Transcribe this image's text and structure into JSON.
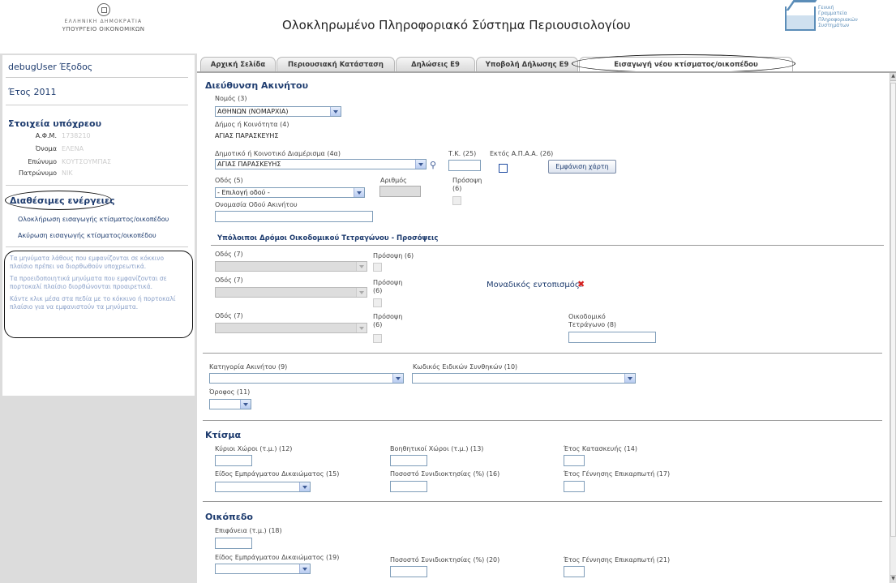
{
  "header": {
    "ministry_line1": "ΕΛΛΗΝΙΚΗ ΔΗΜΟΚΡΑΤΙΑ",
    "ministry_line2": "ΥΠΟΥΡΓΕΙΟ ΟΙΚΟΝΟΜΙΚΩΝ",
    "app_title": "Ολοκληρωμένο Πληροφοριακό Σύστημα Περιουσιολογίου",
    "gsis_text": "Γενική\nΓραμματεία\nΠληροφοριακών\nΣυστημάτων"
  },
  "sidebar": {
    "user": "debugUser",
    "logout": "Έξοδος",
    "year_label": "Έτος 2011",
    "taxpayer_title": "Στοιχεία υπόχρεου",
    "afm_label": "Α.Φ.Μ.",
    "afm_value": "1738210",
    "name_label": "Όνομα",
    "name_value": "ΕΛΕΝΑ",
    "surname_label": "Επώνυμο",
    "surname_value": "ΚΟΥΤΣΟΥΜΠΑΣ",
    "father_label": "Πατρώνυμο",
    "father_value": "ΝΙΚ",
    "actions_title": "Διαθέσιμες ενέργειες",
    "action_complete": "Ολοκλήρωση εισαγωγής κτίσματος/οικοπέδου",
    "action_cancel": "Ακύρωση εισαγωγής κτίσματος/οικοπέδου",
    "help_1": "Τα μηνύματα λάθους που εμφανίζονται σε κόκκινο πλαίσιο πρέπει να διορθωθούν υποχρεωτικά.",
    "help_2": "Τα προειδοποιητικά μηνύματα που εμφανίζονται σε πορτοκαλί πλαίσιο διορθώνονται προαιρετικά.",
    "help_3": "Κάντε κλικ μέσα στα πεδία με το κόκκινο ή πορτοκαλί πλαίσιο για να εμφανιστούν τα μηνύματα."
  },
  "tabs": [
    "Αρχική Σελίδα",
    "Περιουσιακή Κατάσταση",
    "Δηλώσεις Ε9",
    "Υποβολή Δήλωσης Ε9",
    "Εισαγωγή νέου κτίσματος/οικοπέδου"
  ],
  "form": {
    "sec_address": "Διεύθυνση Ακινήτου",
    "nomos_label": "Νομός (3)",
    "nomos_value": "ΑΘΗΝΩΝ (ΝΟΜΑΡΧΙΑ)",
    "dimos_label": "Δήμος ή Κοινότητα (4)",
    "dimos_value": "ΑΓΙΑΣ ΠΑΡΑΣΚΕΥΗΣ",
    "diam_label": "Δημοτικό ή Κοινοτικό Διαμέρισμα (4α)",
    "diam_value": "ΑΓΙΑΣ ΠΑΡΑΣΚΕΥΗΣ",
    "tk_label": "Τ.Κ. (25)",
    "ektos_label": "Εκτός Α.Π.Α.Α. (26)",
    "map_button": "Εμφάνιση χάρτη",
    "odos_label": "Οδός (5)",
    "odos_value": "- Επιλογή οδού -",
    "arithmos_label": "Αριθμός",
    "prosopsi6_label": "Πρόσοψη (6)",
    "onomasia_label": "Ονομασία Οδού Ακινήτου",
    "sub_other": "Υπόλοιποι Δρόμοι Οικοδομικού Τετραγώνου - Προσόψεις",
    "odos7_label": "Οδός (7)",
    "prosopsi_label": "Πρόσοψη (6)",
    "monadikos_label": "Μοναδικός εντοπισμός:",
    "oikodomiko_label": "Οικοδομικό Τετράγωνο (8)",
    "katigoria_label": "Κατηγορία Ακινήτου (9)",
    "kodikos_label": "Κωδικός Ειδικών Συνθηκών (10)",
    "orofos_label": "Όροφος (11)",
    "sec_ktisma": "Κτίσμα",
    "kyrioi_label": "Κύριοι Χώροι (τ.μ.) (12)",
    "voithitikoi_label": "Βοηθητικοί Χώροι (τ.μ.) (13)",
    "etos_kat_label": "Έτος Κατασκευής (14)",
    "eidos15_label": "Είδος Εμπράγματου Δικαιώματος (15)",
    "pososto16_label": "Ποσοστό Συνιδιοκτησίας (%) (16)",
    "etos17_label": "Έτος Γέννησης Επικαρπωτή (17)",
    "sec_oikopedo": "Οικόπεδο",
    "epifaneia_label": "Επιφάνεια (τ.μ.) (18)",
    "eidos19_label": "Είδος Εμπράγματου Δικαιώματος (19)",
    "pososto20_label": "Ποσοστό Συνιδιοκτησίας (%) (20)",
    "etos21_label": "Έτος Γέννησης Επικαρπωτή (21)"
  },
  "colors": {
    "link": "#1d3b6e",
    "sidebar_bg": "#dcdcdc",
    "error_icon": "#d42020"
  }
}
